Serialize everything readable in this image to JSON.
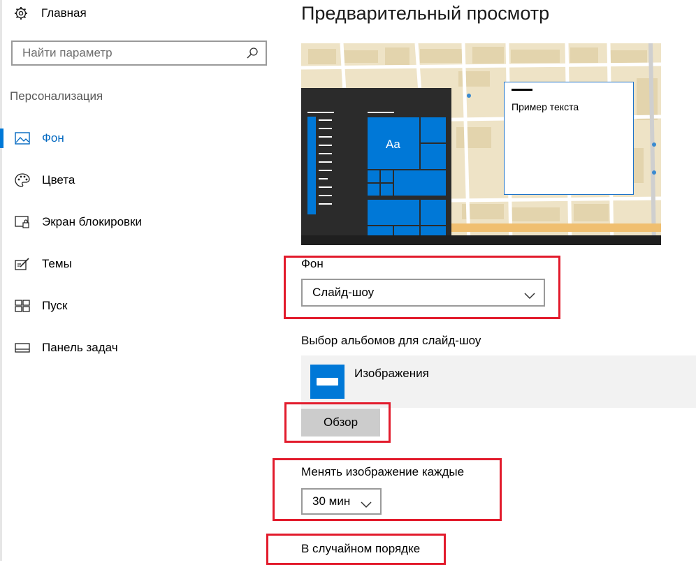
{
  "sidebar": {
    "home_label": "Главная",
    "search_placeholder": "Найти параметр",
    "section_title": "Персонализация",
    "items": [
      {
        "label": "Фон",
        "icon": "picture-icon",
        "active": true
      },
      {
        "label": "Цвета",
        "icon": "palette-icon"
      },
      {
        "label": "Экран блокировки",
        "icon": "lock-screen-icon"
      },
      {
        "label": "Темы",
        "icon": "themes-icon"
      },
      {
        "label": "Пуск",
        "icon": "start-icon"
      },
      {
        "label": "Панель задач",
        "icon": "taskbar-icon"
      }
    ]
  },
  "main": {
    "title": "Предварительный просмотр",
    "preview": {
      "sample_text": "Пример текста",
      "tile_text": "Aa"
    },
    "background": {
      "label": "Фон",
      "value": "Слайд-шоу"
    },
    "albums": {
      "label": "Выбор альбомов для слайд-шоу",
      "album_name": "Изображения",
      "browse_label": "Обзор"
    },
    "interval": {
      "label": "Менять изображение каждые",
      "value": "30 мин"
    },
    "shuffle_label": "В случайном порядке"
  },
  "colors": {
    "accent": "#0078d7",
    "highlight_box": "#e21b2c"
  }
}
